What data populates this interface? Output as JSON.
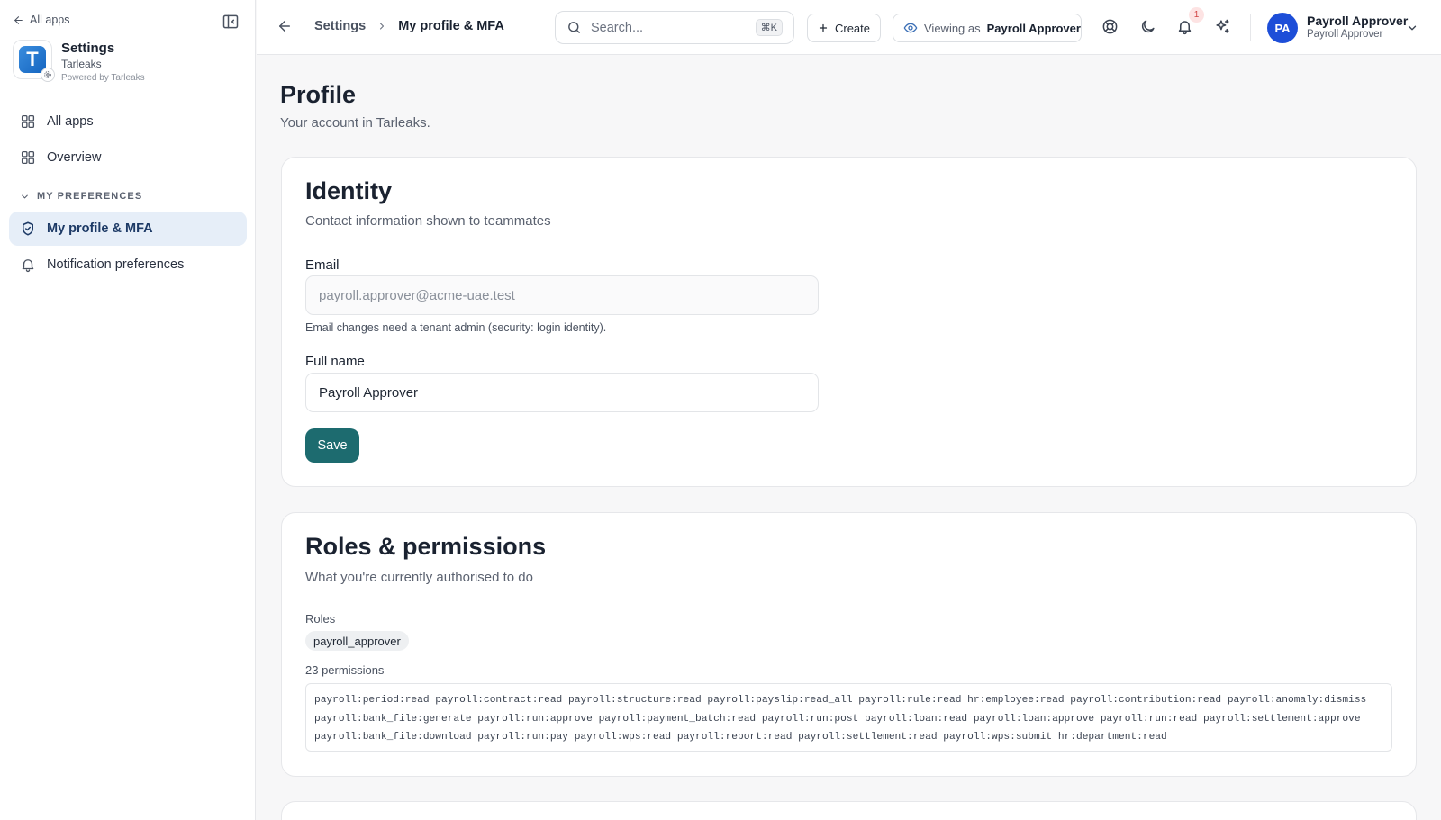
{
  "sidebar": {
    "back_label": "All apps",
    "app": {
      "title": "Settings",
      "org": "Tarleaks",
      "powered": "Powered by Tarleaks",
      "logo_letter": "T",
      "logo_color": "#1e6fd0"
    },
    "items": [
      {
        "label": "All apps",
        "icon": "grid-icon"
      },
      {
        "label": "Overview",
        "icon": "grid-icon"
      }
    ],
    "section": {
      "label": "MY PREFERENCES",
      "items": [
        {
          "label": "My profile & MFA",
          "icon": "shield-icon",
          "active": true
        },
        {
          "label": "Notification preferences",
          "icon": "bell-icon",
          "active": false
        }
      ]
    }
  },
  "header": {
    "breadcrumb": [
      "Settings",
      "My profile & MFA"
    ],
    "search_placeholder": "Search...",
    "search_shortcut": "⌘K",
    "create_label": "Create",
    "viewing_label": "Viewing as",
    "viewing_role": "Payroll Approver",
    "notification_count": "1",
    "user": {
      "initials": "PA",
      "name": "Payroll Approver",
      "role": "Payroll Approver"
    }
  },
  "page": {
    "title": "Profile",
    "subtitle": "Your account in Tarleaks."
  },
  "identity": {
    "title": "Identity",
    "subtitle": "Contact information shown to teammates",
    "email_label": "Email",
    "email_value": "payroll.approver@acme-uae.test",
    "email_hint": "Email changes need a tenant admin (security: login identity).",
    "name_label": "Full name",
    "name_value": "Payroll Approver",
    "save_label": "Save"
  },
  "roles": {
    "title": "Roles & permissions",
    "subtitle": "What you're currently authorised to do",
    "roles_label": "Roles",
    "roles": [
      "payroll_approver"
    ],
    "permissions_count_label": "23 permissions",
    "permissions": [
      "payroll:period:read",
      "payroll:contract:read",
      "payroll:structure:read",
      "payroll:payslip:read_all",
      "payroll:rule:read",
      "hr:employee:read",
      "payroll:contribution:read",
      "payroll:anomaly:dismiss",
      "payroll:bank_file:generate",
      "payroll:run:approve",
      "payroll:payment_batch:read",
      "payroll:run:post",
      "payroll:loan:read",
      "payroll:loan:approve",
      "payroll:run:read",
      "payroll:settlement:approve",
      "payroll:bank_file:download",
      "payroll:run:pay",
      "payroll:wps:read",
      "payroll:report:read",
      "payroll:settlement:read",
      "payroll:wps:submit",
      "hr:department:read"
    ]
  },
  "colors": {
    "accent": "#1d6b6f",
    "active_nav_bg": "#e6eef8",
    "avatar_bg": "#1d4ed8"
  }
}
